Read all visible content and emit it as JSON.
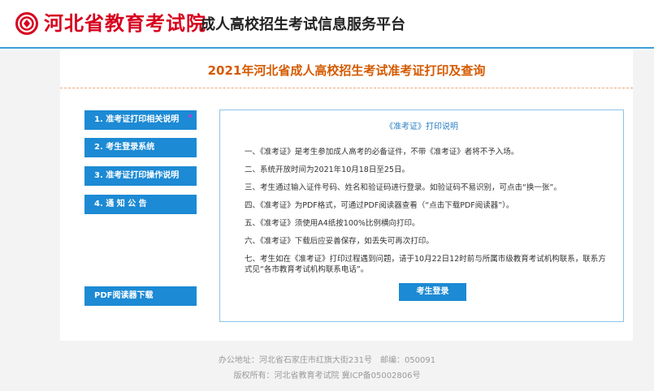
{
  "header": {
    "org_name": "河北省教育考试院",
    "platform_name": "成人高校招生考试信息服务平台",
    "brand_color": "#d7001e"
  },
  "page": {
    "title": "2021年河北省成人高校招生考试准考证打印及查询"
  },
  "menu": [
    {
      "label": "1. 准考证打印相关说明"
    },
    {
      "label": "2. 考生登录系统"
    },
    {
      "label": "3. 准考证打印操作说明"
    },
    {
      "label": "4. 通 知 公 告"
    },
    {
      "label": "PDF阅读器下载"
    }
  ],
  "info": {
    "title": "《准考证》打印说明",
    "items": [
      "一、《准考证》是考生参加成人高考的必备证件，不带《准考证》者将不予入场。",
      "二、系统开放时间为2021年10月18日至25日。",
      "三、考生通过输入证件号码、姓名和验证码进行登录。如验证码不易识别，可点击“换一张”。",
      "四、《准考证》为PDF格式，可通过PDF阅读器查看（“点击下载PDF阅读器”）。",
      "五、《准考证》须使用A4纸按100%比例横向打印。",
      "六、《准考证》下载后应妥善保存，如丢失可再次打印。",
      "七、考生如在《准考证》打印过程遇到问题，请于10月22日12时前与所属市级教育考试机构联系，联系方式见“各市教育考试机构联系电话”。"
    ],
    "login_label": "考生登录"
  },
  "footer": {
    "address": "办公地址：河北省石家庄市红旗大街231号　邮编：050091",
    "copyright": "版权所有：河北省教育考试院 冀ICP备05002806号"
  },
  "colors": {
    "accent_blue": "#1c8ad4",
    "title_orange": "#d55a00",
    "header_line": "#3b9fd6"
  }
}
